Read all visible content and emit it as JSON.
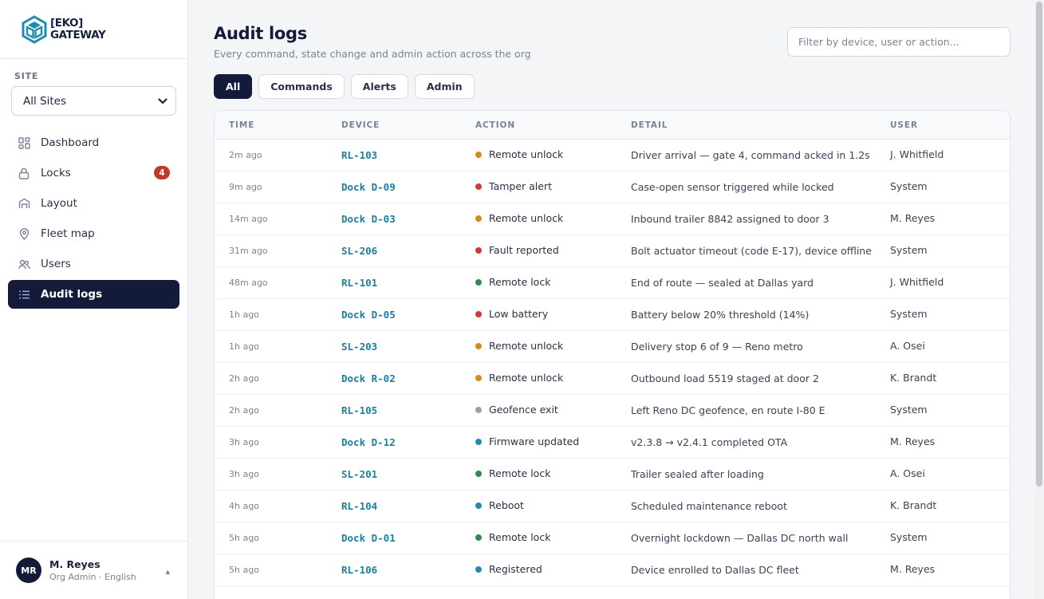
{
  "brand": {
    "line1": "[EKO]",
    "line2": "GATEWAY"
  },
  "site": {
    "label": "SITE",
    "selected": "All Sites"
  },
  "nav": {
    "items": [
      {
        "label": "Dashboard",
        "icon": "dashboard-icon"
      },
      {
        "label": "Locks",
        "icon": "lock-icon",
        "badge": "4"
      },
      {
        "label": "Layout",
        "icon": "layout-icon"
      },
      {
        "label": "Fleet map",
        "icon": "map-pin-icon"
      },
      {
        "label": "Users",
        "icon": "users-icon"
      },
      {
        "label": "Audit logs",
        "icon": "list-icon",
        "active": true
      }
    ]
  },
  "user": {
    "initials": "MR",
    "name": "M. Reyes",
    "role": "Org Admin · English"
  },
  "page": {
    "title": "Audit logs",
    "subtitle": "Every command, state change and admin action across the org"
  },
  "filter": {
    "placeholder": "Filter by device, user or action..."
  },
  "tabs": [
    {
      "label": "All",
      "active": true
    },
    {
      "label": "Commands"
    },
    {
      "label": "Alerts"
    },
    {
      "label": "Admin"
    }
  ],
  "table": {
    "headers": {
      "time": "TIME",
      "device": "DEVICE",
      "action": "ACTION",
      "detail": "DETAIL",
      "user": "USER"
    },
    "colors": {
      "orange": "#d68a1e",
      "red": "#cc3b3b",
      "green": "#2e8b4f",
      "gray": "#9aa1ae",
      "blue": "#1f8bb0"
    },
    "rows": [
      {
        "time": "2m ago",
        "device": "RL-103",
        "action": "Remote unlock",
        "status": "orange",
        "detail": "Driver arrival — gate 4, command acked in 1.2s",
        "user": "J. Whitfield"
      },
      {
        "time": "9m ago",
        "device": "Dock D-09",
        "action": "Tamper alert",
        "status": "red",
        "detail": "Case-open sensor triggered while locked",
        "user": "System"
      },
      {
        "time": "14m ago",
        "device": "Dock D-03",
        "action": "Remote unlock",
        "status": "orange",
        "detail": "Inbound trailer 8842 assigned to door 3",
        "user": "M. Reyes"
      },
      {
        "time": "31m ago",
        "device": "SL-206",
        "action": "Fault reported",
        "status": "red",
        "detail": "Bolt actuator timeout (code E-17), device offline",
        "user": "System"
      },
      {
        "time": "48m ago",
        "device": "RL-101",
        "action": "Remote lock",
        "status": "green",
        "detail": "End of route — sealed at Dallas yard",
        "user": "J. Whitfield"
      },
      {
        "time": "1h ago",
        "device": "Dock D-05",
        "action": "Low battery",
        "status": "red",
        "detail": "Battery below 20% threshold (14%)",
        "user": "System"
      },
      {
        "time": "1h ago",
        "device": "SL-203",
        "action": "Remote unlock",
        "status": "orange",
        "detail": "Delivery stop 6 of 9 — Reno metro",
        "user": "A. Osei"
      },
      {
        "time": "2h ago",
        "device": "Dock R-02",
        "action": "Remote unlock",
        "status": "orange",
        "detail": "Outbound load 5519 staged at door 2",
        "user": "K. Brandt"
      },
      {
        "time": "2h ago",
        "device": "RL-105",
        "action": "Geofence exit",
        "status": "gray",
        "detail": "Left Reno DC geofence, en route I-80 E",
        "user": "System"
      },
      {
        "time": "3h ago",
        "device": "Dock D-12",
        "action": "Firmware updated",
        "status": "blue",
        "detail": "v2.3.8 → v2.4.1 completed OTA",
        "user": "M. Reyes"
      },
      {
        "time": "3h ago",
        "device": "SL-201",
        "action": "Remote lock",
        "status": "green",
        "detail": "Trailer sealed after loading",
        "user": "A. Osei"
      },
      {
        "time": "4h ago",
        "device": "RL-104",
        "action": "Reboot",
        "status": "blue",
        "detail": "Scheduled maintenance reboot",
        "user": "K. Brandt"
      },
      {
        "time": "5h ago",
        "device": "Dock D-01",
        "action": "Remote lock",
        "status": "green",
        "detail": "Overnight lockdown — Dallas DC north wall",
        "user": "System"
      },
      {
        "time": "5h ago",
        "device": "RL-106",
        "action": "Registered",
        "status": "blue",
        "detail": "Device enrolled to Dallas DC fleet",
        "user": "M. Reyes"
      }
    ]
  }
}
